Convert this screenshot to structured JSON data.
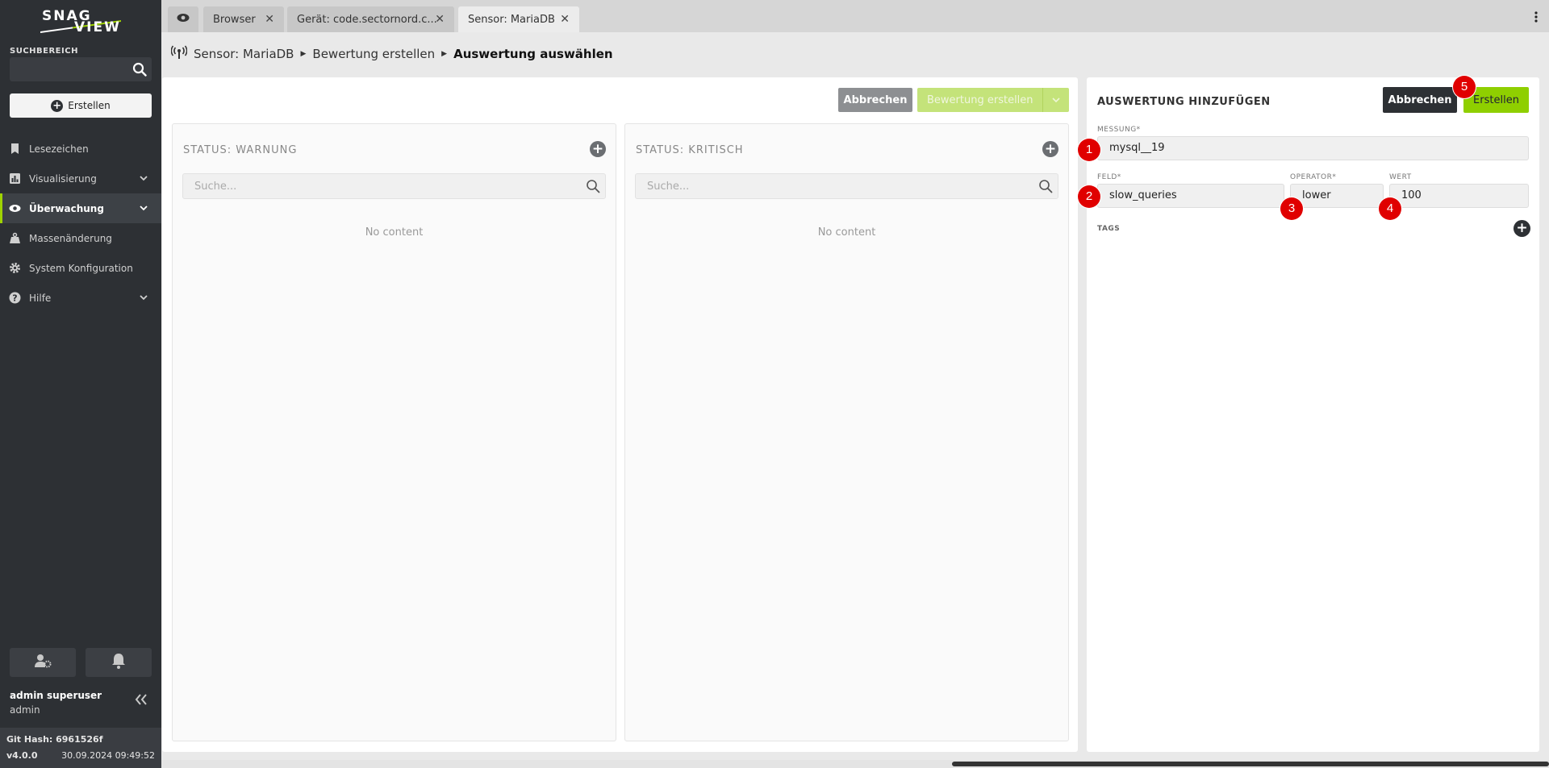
{
  "app": {
    "logo_text": "SNAG VIEW"
  },
  "sidebar": {
    "search_label": "SUCHBEREICH",
    "search_value": "",
    "create_label": "Erstellen",
    "items": [
      {
        "label": "Lesezeichen",
        "icon": "bookmark-icon"
      },
      {
        "label": "Visualisierung",
        "icon": "chart-icon"
      },
      {
        "label": "Überwachung",
        "icon": "eye-icon",
        "active": true
      },
      {
        "label": "Massenänderung",
        "icon": "weight-icon"
      },
      {
        "label": "System Konfiguration",
        "icon": "gear-icon"
      },
      {
        "label": "Hilfe",
        "icon": "help-icon"
      }
    ],
    "user_name": "admin superuser",
    "user_role": "admin",
    "git_hash": "Git Hash: 6961526f",
    "version": "v4.0.0",
    "datetime": "30.09.2024 09:49:52"
  },
  "tabs": [
    {
      "label": "Browser"
    },
    {
      "label": "Gerät: code.sectornord.c..."
    },
    {
      "label": "Sensor: MariaDB",
      "active": true
    }
  ],
  "breadcrumb": {
    "items": [
      "Sensor: MariaDB",
      "Bewertung erstellen",
      "Auswertung auswählen"
    ]
  },
  "left_panel": {
    "cancel_label": "Abbrechen",
    "create_label": "Bewertung erstellen",
    "columns": [
      {
        "title": "STATUS: WARNUNG",
        "search_placeholder": "Suche...",
        "empty_text": "No content"
      },
      {
        "title": "STATUS: KRITISCH",
        "search_placeholder": "Suche...",
        "empty_text": "No content"
      }
    ]
  },
  "right_panel": {
    "title": "AUSWERTUNG HINZUFÜGEN",
    "cancel_label": "Abbrechen",
    "create_label": "Erstellen",
    "messung_label": "MESSUNG*",
    "messung_value": "mysql__19",
    "feld_label": "FELD*",
    "feld_value": "slow_queries",
    "operator_label": "OPERATOR*",
    "operator_value": "lower",
    "wert_label": "WERT",
    "wert_value": "100",
    "tags_label": "TAGS"
  },
  "markers": [
    "1",
    "2",
    "3",
    "4",
    "5"
  ],
  "colors": {
    "sidebar_bg": "#2d3034",
    "accent_green": "#8fcf00",
    "marker_red": "#e00000"
  }
}
